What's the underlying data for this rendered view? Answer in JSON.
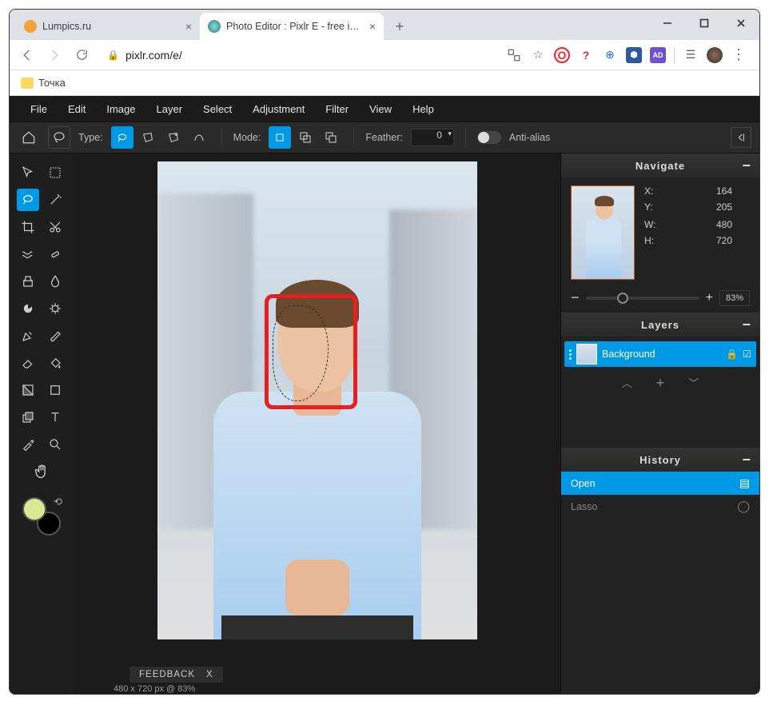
{
  "browser": {
    "tabs": [
      {
        "title": "Lumpics.ru"
      },
      {
        "title": "Photo Editor : Pixlr E - free image"
      }
    ],
    "url": "pixlr.com/e/",
    "bookmark": "Точка"
  },
  "menu": [
    "File",
    "Edit",
    "Image",
    "Layer",
    "Select",
    "Adjustment",
    "Filter",
    "View",
    "Help"
  ],
  "toolbar": {
    "type_label": "Type:",
    "mode_label": "Mode:",
    "feather_label": "Feather:",
    "feather_value": "0",
    "antialias_label": "Anti-alias"
  },
  "panels": {
    "navigate": {
      "title": "Navigate",
      "x_label": "X:",
      "x": "164",
      "y_label": "Y:",
      "y": "205",
      "w_label": "W:",
      "w": "480",
      "h_label": "H:",
      "h": "720",
      "zoom_minus": "−",
      "zoom_plus": "+",
      "zoom": "83%"
    },
    "layers": {
      "title": "Layers",
      "items": [
        {
          "name": "Background"
        }
      ]
    },
    "history": {
      "title": "History",
      "items": [
        {
          "name": "Open",
          "active": true
        },
        {
          "name": "Lasso",
          "active": false
        }
      ]
    }
  },
  "feedback": {
    "label": "FEEDBACK",
    "close": "X"
  },
  "status": "480 x 720 px @ 83%",
  "colors": {
    "fg": "#d6e993",
    "bg": "#000000",
    "accent": "#0099e5",
    "highlight": "#e62020"
  }
}
